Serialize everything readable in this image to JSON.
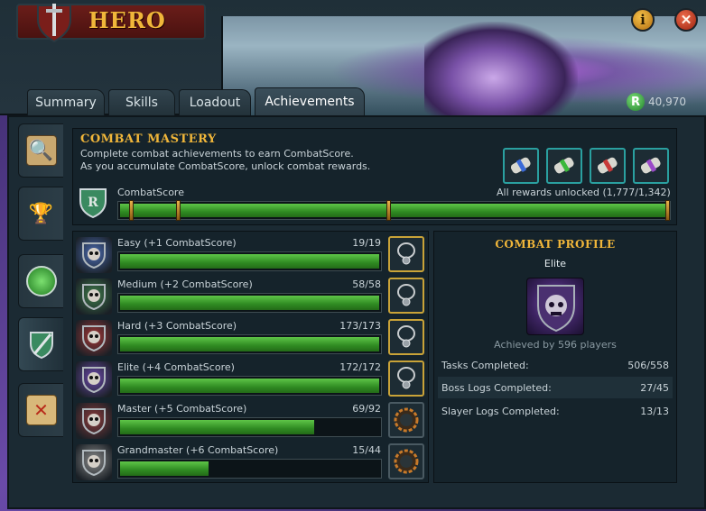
{
  "header": {
    "title": "HERO",
    "tabs": [
      {
        "label": "Summary"
      },
      {
        "label": "Skills"
      },
      {
        "label": "Loadout"
      },
      {
        "label": "Achievements"
      }
    ],
    "active_tab": "Achievements",
    "currency_symbol": "R",
    "currency_amount": "40,970",
    "info_icon": "info-icon",
    "close_icon": "close-icon"
  },
  "side_tabs": [
    {
      "icon": "magnifier-scroll-icon"
    },
    {
      "icon": "trophy-icon"
    },
    {
      "icon": "green-medallion-icon"
    },
    {
      "icon": "shield-sword-icon"
    },
    {
      "icon": "treasure-map-icon"
    }
  ],
  "mastery": {
    "title": "COMBAT MASTERY",
    "desc_line1": "Complete combat achievements to earn CombatScore.",
    "desc_line2": "As you accumulate CombatScore, unlock combat rewards.",
    "score_label": "CombatScore",
    "unlock_text": "All rewards unlocked (1,777/1,342)",
    "score_fraction": 1.0,
    "rewards": [
      {
        "icon": "blue-scroll-icon",
        "color": "#3a6ad8"
      },
      {
        "icon": "green-scroll-icon",
        "color": "#3ab83a"
      },
      {
        "icon": "red-scroll-icon",
        "color": "#c83a3a"
      },
      {
        "icon": "purple-scroll-icon",
        "color": "#9a4ac8"
      }
    ]
  },
  "tiers": [
    {
      "label": "Easy (+1 CombatScore)",
      "count": "19/19",
      "progress": 1.0,
      "emblem_color": "#4a6ab0",
      "reward": "necklace",
      "complete": true
    },
    {
      "label": "Medium (+2 CombatScore)",
      "count": "58/58",
      "progress": 1.0,
      "emblem_color": "#3f7a4a",
      "reward": "necklace",
      "complete": true
    },
    {
      "label": "Hard (+3 CombatScore)",
      "count": "173/173",
      "progress": 1.0,
      "emblem_color": "#a03636",
      "reward": "necklace",
      "complete": true
    },
    {
      "label": "Elite (+4 CombatScore)",
      "count": "172/172",
      "progress": 1.0,
      "emblem_color": "#6a48a8",
      "reward": "necklace",
      "complete": true
    },
    {
      "label": "Master (+5 CombatScore)",
      "count": "69/92",
      "progress": 0.75,
      "emblem_color": "#8a3a3a",
      "reward": "locked",
      "complete": false
    },
    {
      "label": "Grandmaster (+6 CombatScore)",
      "count": "15/44",
      "progress": 0.34,
      "emblem_color": "#8a8a8a",
      "reward": "locked",
      "complete": false
    }
  ],
  "profile": {
    "title": "COMBAT PROFILE",
    "rank": "Elite",
    "achieved": "Achieved by 596 players",
    "stats": [
      {
        "label": "Tasks Completed:",
        "value": "506/558"
      },
      {
        "label": "Boss Logs Completed:",
        "value": "27/45"
      },
      {
        "label": "Slayer Logs Completed:",
        "value": "13/13"
      }
    ]
  }
}
